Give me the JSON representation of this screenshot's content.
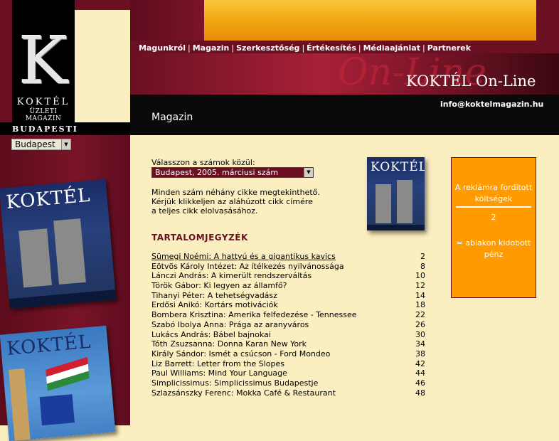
{
  "logo": {
    "letter": "K",
    "name": "KOKTÉL",
    "subtitle": "ÜZLETI MAGAZIN"
  },
  "city": {
    "label": "BUDAPESTI",
    "selected": "Budapest"
  },
  "nav": {
    "items": [
      "Magunkról",
      "Magazin",
      "Szerkesztőség",
      "Értékesítés",
      "Médiaajánlat",
      "Partnerek"
    ]
  },
  "header": {
    "ghost_text": "On-Line",
    "site_title": "KOKTÉL On-Line",
    "email": "info@koktelmagazin.hu",
    "section_title": "Magazin"
  },
  "covers": {
    "title": "KOKTÉL"
  },
  "content": {
    "choose_label": "Válasszon a számok közül:",
    "issue_selected": "Budapest, 2005. márciusi szám",
    "intro": [
      "Minden szám néhány cikke megtekinthető.",
      "Kérjük klikkeljen az aláhúzott cikk címére",
      "a teljes cikk elolvasásához."
    ],
    "toc_title": "TARTALOMJEGYZÉK",
    "toc": [
      {
        "title": "Sümegi Noémi: A hattyú és a gigantikus kavics",
        "page": "2"
      },
      {
        "title": "Eötvös Károly Intézet: Az ítélkezés nyilvánossága",
        "page": "8"
      },
      {
        "title": "Lánczi András: A kimerült rendszerváltás",
        "page": "10"
      },
      {
        "title": "Török Gábor: Ki legyen az államfő?",
        "page": "12"
      },
      {
        "title": "Tihanyi Péter: A tehetségvadász",
        "page": "14"
      },
      {
        "title": "Erdősi Anikó: Kortárs motivációk",
        "page": "18"
      },
      {
        "title": "Bombera Krisztina: Amerika felfedezése - Tennessee",
        "page": "22"
      },
      {
        "title": "Szabó Ibolya Anna: Prága az aranyváros",
        "page": "26"
      },
      {
        "title": "Lukács András: Bábel bajnokai",
        "page": "30"
      },
      {
        "title": "Tóth Zsuzsanna: Donna Karan New York",
        "page": "34"
      },
      {
        "title": "Király Sándor: Ismét a csúcson - Ford Mondeo",
        "page": "38"
      },
      {
        "title": "Liz Barrett: Letter from the Slopes",
        "page": "42"
      },
      {
        "title": "Paul Williams: Mind Your Language",
        "page": "44"
      },
      {
        "title": "Simplicissimus: Simplicissimus Budapestje",
        "page": "46"
      },
      {
        "title": "Szlazsánszky Ferenc: Mokka Café & Restaurant",
        "page": "48"
      }
    ]
  },
  "ad": {
    "line1": "A reklámra fordított",
    "line2": "költségek",
    "number": "2",
    "line3": "= ablakon kidobott",
    "line4": "pénz"
  },
  "colors": {
    "maroon": "#6a1022",
    "cream": "#fbeec0",
    "orange": "#ff9a00",
    "gold": "#f2a812"
  }
}
